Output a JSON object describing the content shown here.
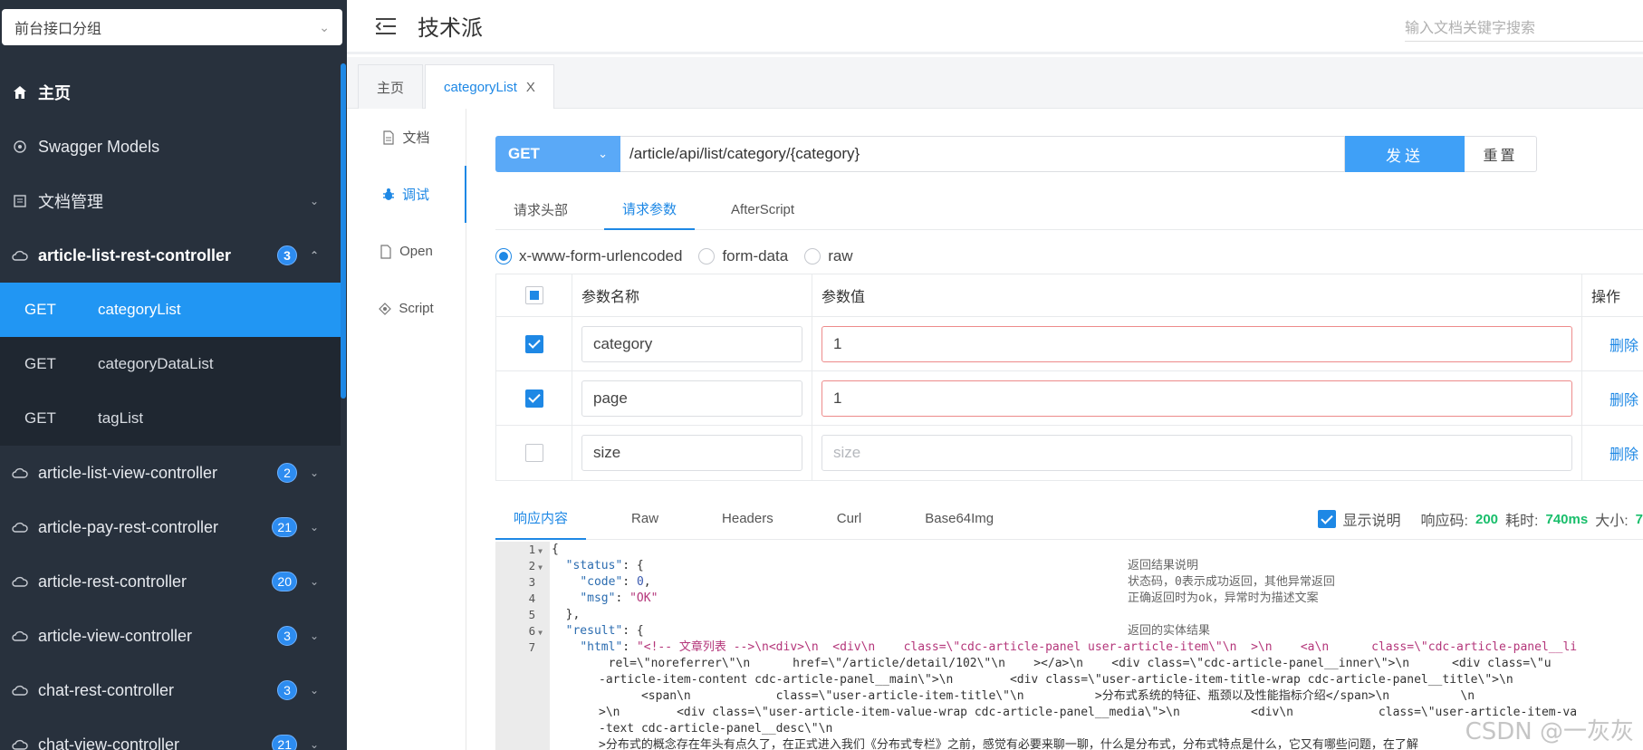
{
  "sidebar": {
    "group_select": "前台接口分组",
    "items": [
      {
        "label": "主页",
        "icon": "home-icon"
      },
      {
        "label": "Swagger Models",
        "icon": "model-icon"
      },
      {
        "label": "文档管理",
        "icon": "doc-manage-icon"
      }
    ],
    "controllers": [
      {
        "label": "article-list-rest-controller",
        "count": "3",
        "expanded": true
      },
      {
        "label": "article-list-view-controller",
        "count": "2"
      },
      {
        "label": "article-pay-rest-controller",
        "count": "21"
      },
      {
        "label": "article-rest-controller",
        "count": "20"
      },
      {
        "label": "article-view-controller",
        "count": "3"
      },
      {
        "label": "chat-rest-controller",
        "count": "3"
      },
      {
        "label": "chat-view-controller",
        "count": "21"
      }
    ],
    "apis": [
      {
        "method": "GET",
        "name": "categoryList",
        "active": true
      },
      {
        "method": "GET",
        "name": "categoryDataList"
      },
      {
        "method": "GET",
        "name": "tagList"
      }
    ]
  },
  "header": {
    "title": "技术派",
    "search_placeholder": "输入文档关键字搜索"
  },
  "tabs": {
    "home": "主页",
    "active": "categoryList",
    "close": "X"
  },
  "side_tabs": [
    "文档",
    "调试",
    "Open",
    "Script"
  ],
  "request": {
    "method": "GET",
    "url": "/article/api/list/category/{category}",
    "send": "发送",
    "reset": "重置"
  },
  "param_tabs": [
    "请求头部",
    "请求参数",
    "AfterScript"
  ],
  "content_types": [
    "x-www-form-urlencoded",
    "form-data",
    "raw"
  ],
  "params": {
    "headers": {
      "name": "参数名称",
      "value": "参数值",
      "op": "操作"
    },
    "rows": [
      {
        "name": "category",
        "value": "1",
        "checked": true,
        "delete": "删除"
      },
      {
        "name": "page",
        "value": "1",
        "checked": true,
        "delete": "删除"
      },
      {
        "name": "size",
        "value": "",
        "placeholder": "size",
        "checked": false,
        "delete": "删除"
      }
    ]
  },
  "response": {
    "tabs": [
      "响应内容",
      "Raw",
      "Headers",
      "Curl",
      "Base64Img"
    ],
    "show_desc": "显示说明",
    "code_label": "响应码:",
    "code": "200",
    "time_label": "耗时:",
    "time": "740ms",
    "size_label": "大小:",
    "size": "7"
  },
  "code": {
    "line_numbers": [
      "1",
      "2",
      "3",
      "4",
      "5",
      "6",
      "7"
    ],
    "comments": [
      "返回结果说明",
      "状态码，0表示成功返回，其他异常返回",
      "正确返回时为ok，异常时为描述文案",
      "返回的实体结果"
    ],
    "html_line1": "\"<!-- 文章列表 -->\\n<div>\\n  <div\\n    class=\\\"cdc-article-panel user-article-item\\\"\\n  >\\n    <a\\n      class=\\\"cdc-article-panel__li",
    "html_line2": "        rel=\\\"noreferrer\\\"\\n      href=\\\"/article/detail/102\\\"\\n    ></a>\\n    <div class=\\\"cdc-article-panel__inner\\\">\\n      <div class=\\\"u",
    "html_line3": "-article-item-content cdc-article-panel__main\\\">\\n        <div class=\\\"user-article-item-title-wrap cdc-article-panel__title\\\">\\n",
    "html_line4": "      <span\\n            class=\\\"user-article-item-title\\\"\\n          >分布式系统的特征、瓶颈以及性能指标介绍</span>\\n          \\n",
    "html_line5": ">\\n        <div class=\\\"user-article-item-value-wrap cdc-article-panel__media\\\">\\n          <div\\n            class=\\\"user-article-item-va",
    "html_line6": "-text cdc-article-panel__desc\\\"\\n",
    "html_line7": ">分布式的概念存在年头有点久了，在正式进入我们《分布式专栏》之前，感觉有必要来聊一聊，什么是分布式，分布式特点是什么，它又有哪些问题，在了解",
    "watermark": "CSDN @一灰灰"
  },
  "colors": {
    "accent": "#1e88e5",
    "sidebar_bg": "#28313d",
    "active_item": "#2196f3"
  }
}
